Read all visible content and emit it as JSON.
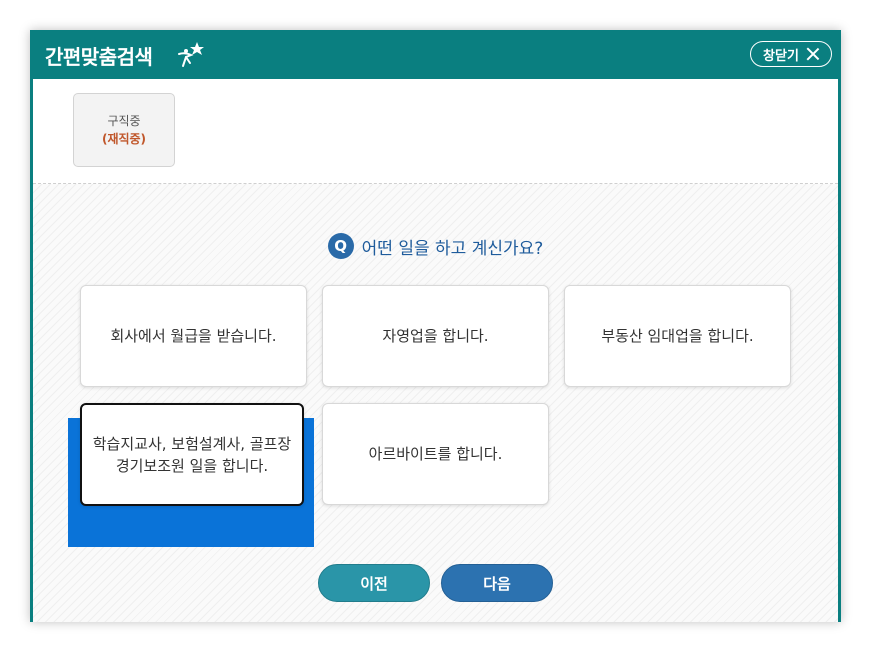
{
  "header": {
    "title": "간편맞춤검색",
    "close_label": "창닫기"
  },
  "status": {
    "main": "구직중",
    "sub": "(재직중)"
  },
  "question": {
    "badge": "Q",
    "text": "어떤 일을 하고 계신가요?"
  },
  "options": [
    {
      "label": "회사에서 월급을 받습니다."
    },
    {
      "label": "자영업을 합니다."
    },
    {
      "label": "부동산 임대업을 합니다."
    },
    {
      "label": "학습지교사, 보험설계사, 골프장 경기보조원 일을 합니다.",
      "selected": true
    },
    {
      "label": "아르바이트를 합니다."
    }
  ],
  "buttons": {
    "prev": "이전",
    "next": "다음"
  },
  "colors": {
    "header": "#0a7f80",
    "accent": "#2a6aa8",
    "focus": "#0a73d8",
    "status_sub": "#c0562a"
  }
}
